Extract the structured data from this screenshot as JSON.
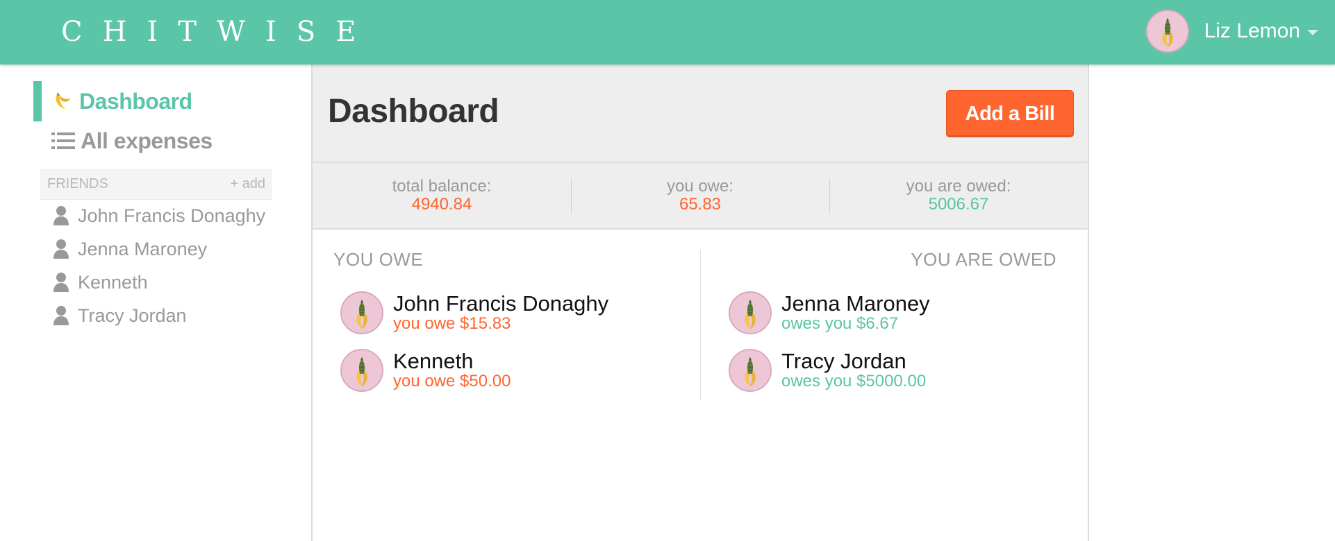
{
  "app": {
    "brand": "CHITWISE",
    "user_name": "Liz Lemon"
  },
  "sidebar": {
    "nav": [
      {
        "label": "Dashboard",
        "icon": "banana-icon",
        "active": true
      },
      {
        "label": "All expenses",
        "icon": "list-icon",
        "active": false
      }
    ],
    "friends_header": "FRIENDS",
    "friends_add": "+ add",
    "friends": [
      {
        "label": "John Francis Donaghy",
        "icon": "person-icon"
      },
      {
        "label": "Jenna Maroney",
        "icon": "person-icon"
      },
      {
        "label": "Kenneth",
        "icon": "person-icon"
      },
      {
        "label": "Tracy Jordan",
        "icon": "person-icon"
      }
    ]
  },
  "main": {
    "title": "Dashboard",
    "add_bill_label": "Add a Bill",
    "balances": {
      "total_label": "total balance:",
      "total_value": "4940.84",
      "owe_label": "you owe:",
      "owe_value": "65.83",
      "owed_label": "you are owed:",
      "owed_value": "5006.67"
    },
    "you_owe_title": "YOU OWE",
    "you_are_owed_title": "YOU ARE OWED",
    "you_owe": [
      {
        "name": "John Francis Donaghy",
        "amount": "you owe $15.83"
      },
      {
        "name": "Kenneth",
        "amount": "you owe $50.00"
      }
    ],
    "you_are_owed": [
      {
        "name": "Jenna Maroney",
        "amount": "owes you $6.67"
      },
      {
        "name": "Tracy Jordan",
        "amount": "owes you $5000.00"
      }
    ]
  },
  "colors": {
    "brand_green": "#5ac5a7",
    "accent_orange": "#ff652f",
    "avatar_pink": "#eec7d6",
    "muted_text": "#999999"
  }
}
